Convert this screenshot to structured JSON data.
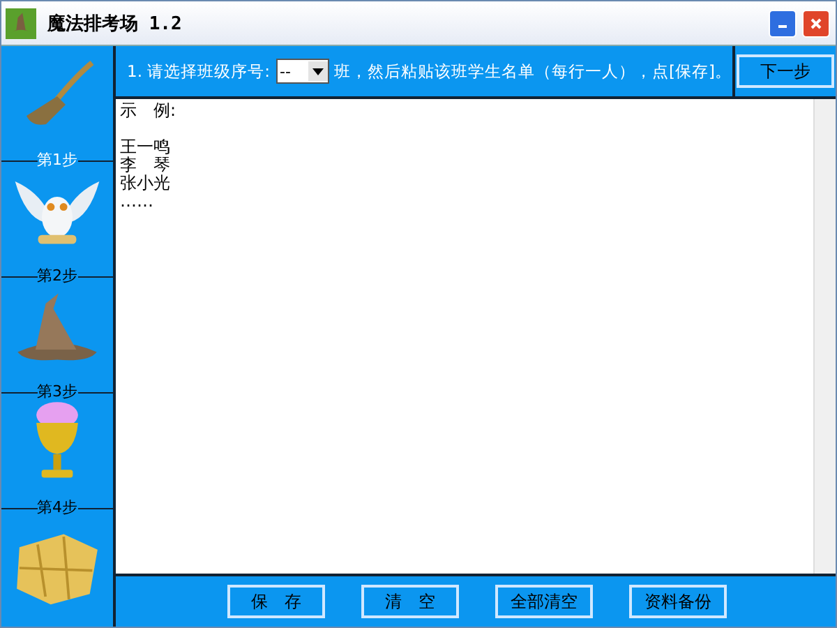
{
  "window": {
    "title": "魔法排考场 1.2"
  },
  "steps": [
    {
      "label": "第1步",
      "selected": true
    },
    {
      "label": "第2步",
      "selected": false
    },
    {
      "label": "第3步",
      "selected": false
    },
    {
      "label": "第4步",
      "selected": false
    }
  ],
  "instruction": {
    "prefix": "1. 请选择班级序号:",
    "class_select": "--",
    "suffix": "班，然后粘贴该班学生名单（每行一人），点[保存]。"
  },
  "next_button": "下一步",
  "editor": {
    "lines": [
      "示　例:",
      "王一鸣",
      "李　琴",
      "张小光",
      "……"
    ]
  },
  "buttons": [
    "保　存",
    "清　空",
    "全部清空",
    "资料备份"
  ]
}
